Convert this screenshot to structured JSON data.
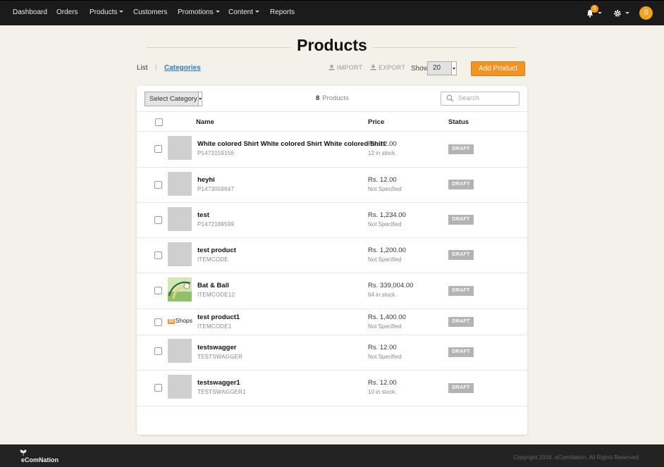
{
  "nav": {
    "items": [
      {
        "label": "Dashboard",
        "dropdown": false
      },
      {
        "label": "Orders",
        "dropdown": false
      },
      {
        "label": "Products",
        "dropdown": true
      },
      {
        "label": "Customers",
        "dropdown": false
      },
      {
        "label": "Promotions",
        "dropdown": true
      },
      {
        "label": "Content",
        "dropdown": true
      },
      {
        "label": "Reports",
        "dropdown": false
      }
    ],
    "notifications_count": "5",
    "user_initial": "S",
    "accent_color": "#f39c12"
  },
  "page": {
    "title": "Products",
    "tab_list": "List",
    "tab_categories": "Categories",
    "import_label": "IMPORT",
    "export_label": "EXPORT",
    "show_label": "Show",
    "show_value": "20",
    "add_button": "Add Product"
  },
  "table": {
    "category_select": "Select Category",
    "count": "8",
    "count_label": "Products",
    "search_placeholder": "Search",
    "headers": {
      "name": "Name",
      "price": "Price",
      "status": "Status"
    },
    "rows": [
      {
        "name": "White colored Shirt White colored Shirt White colored Shirt",
        "code": "P1473159156",
        "price": "Rs. 12.00",
        "stock": "12 in stock.",
        "status": "DRAFT",
        "thumb": "placeholder"
      },
      {
        "name": "heyhi",
        "code": "P1473059647",
        "price": "Rs. 12.00",
        "stock": "Not Specified",
        "status": "DRAFT",
        "thumb": "placeholder"
      },
      {
        "name": "test",
        "code": "P1472189599",
        "price": "Rs. 1,234.00",
        "stock": "Not Specified",
        "status": "DRAFT",
        "thumb": "placeholder"
      },
      {
        "name": "test product",
        "code": "ITEMCODE",
        "price": "Rs. 1,200.00",
        "stock": "Not Specified",
        "status": "DRAFT",
        "thumb": "placeholder"
      },
      {
        "name": "Bat & Ball",
        "code": "ITEMCODE12",
        "price": "Rs. 339,004.00",
        "stock": "64 in stock.",
        "status": "DRAFT",
        "thumb": "image"
      },
      {
        "name": "test product1",
        "code": "ITEMCODE1",
        "price": "Rs. 1,400.00",
        "stock": "Not Specified",
        "status": "DRAFT",
        "thumb": "logo",
        "logo_badge": "30",
        "logo_text": "Shops"
      },
      {
        "name": "testswagger",
        "code": "TESTSWAGGER",
        "price": "Rs. 12.00",
        "stock": "Not Specified",
        "status": "DRAFT",
        "thumb": "placeholder"
      },
      {
        "name": "testswagger1",
        "code": "TESTSWAGGER1",
        "price": "Rs. 12.00",
        "stock": "10 in stock.",
        "status": "DRAFT",
        "thumb": "placeholder"
      }
    ]
  },
  "footer": {
    "brand": "eComNation",
    "copyright": "Copyright 2016, eComNation. All Rights Reserved."
  }
}
